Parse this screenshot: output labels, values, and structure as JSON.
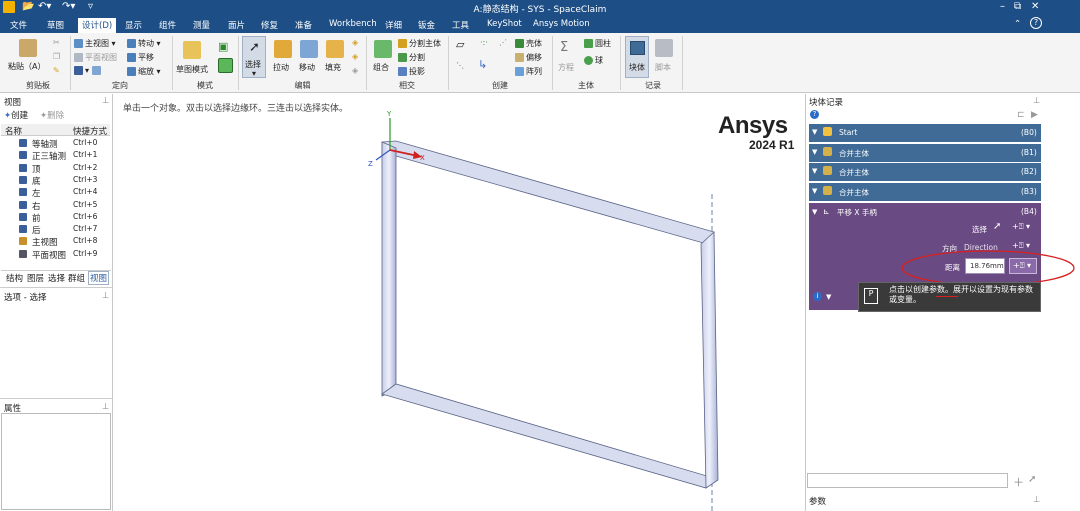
{
  "titlebar": {
    "title": "A:静态结构 - SYS - SpaceClaim",
    "min": "–",
    "restore": "⧉",
    "close": "✕"
  },
  "menu": [
    "文件",
    "草图",
    "设计(D)",
    "显示",
    "组件",
    "测量",
    "面片",
    "修复",
    "准备",
    "Workbench",
    "详细",
    "钣金",
    "工具",
    "KeyShot",
    "Ansys Motion"
  ],
  "ribbon": {
    "paste": "粘贴（A）",
    "clipboard_group": "剪贴板",
    "home_view": "主视图",
    "plane_view": "平面视图",
    "rotate": "转动",
    "pan": "平移",
    "zoom": "缩放",
    "orient_group": "定向",
    "sketch_mode": "草图模式",
    "mode_group": "模式",
    "select": "选择",
    "pull": "拉动",
    "move": "移动",
    "fill": "填充",
    "edit_group": "编辑",
    "combine": "组合",
    "split_body": "分割主体",
    "split": "分割",
    "project": "投影",
    "intersect_group": "相交",
    "shell": "壳体",
    "offset": "偏移",
    "pattern": "阵列",
    "create_group": "创建",
    "equation": "方程",
    "cylinder": "圆柱",
    "sphere": "球",
    "body_group": "主体",
    "block": "块体",
    "script": "脚本",
    "record_group": "记录"
  },
  "views_pane": {
    "title": "视图",
    "create": "创建",
    "delete": "删除",
    "col_name": "名称",
    "col_shortcut": "快捷方式",
    "items": [
      {
        "name": "等轴测",
        "key": "Ctrl+0"
      },
      {
        "name": "正三轴测",
        "key": "Ctrl+1"
      },
      {
        "name": "顶",
        "key": "Ctrl+2"
      },
      {
        "name": "底",
        "key": "Ctrl+3"
      },
      {
        "name": "左",
        "key": "Ctrl+4"
      },
      {
        "name": "右",
        "key": "Ctrl+5"
      },
      {
        "name": "前",
        "key": "Ctrl+6"
      },
      {
        "name": "后",
        "key": "Ctrl+7"
      },
      {
        "name": "主视图",
        "key": "Ctrl+8"
      },
      {
        "name": "平面视图",
        "key": "Ctrl+9"
      }
    ],
    "tabs": [
      "结构",
      "图层",
      "选择",
      "群组",
      "视图"
    ]
  },
  "options_pane": {
    "title": "选项 - 选择"
  },
  "props_pane": {
    "title": "属性"
  },
  "viewport": {
    "hint": "单击一个对象。双击以选择边缘环。三连击以选择实体。",
    "brand": "Ansys",
    "version": "2024 R1",
    "axis_x": "X",
    "axis_y": "Y",
    "axis_z": "Z"
  },
  "block_record": {
    "title": "块体记录",
    "blocks": [
      {
        "label": "Start",
        "id": "(B0)"
      },
      {
        "label": "合并主体",
        "id": "(B1)"
      },
      {
        "label": "合并主体",
        "id": "(B2)"
      },
      {
        "label": "合并主体",
        "id": "(B3)"
      }
    ],
    "active": {
      "label": "平移 X 手柄",
      "id": "(B4)",
      "select_label": "选择",
      "direction_label": "方向",
      "direction_value": "Direction",
      "distance_label": "距离",
      "distance_value": "18.76mm"
    },
    "tooltip": "点击以创建参数。展开以设置为现有参数或变量。"
  },
  "params_pane": {
    "title": "参数"
  }
}
